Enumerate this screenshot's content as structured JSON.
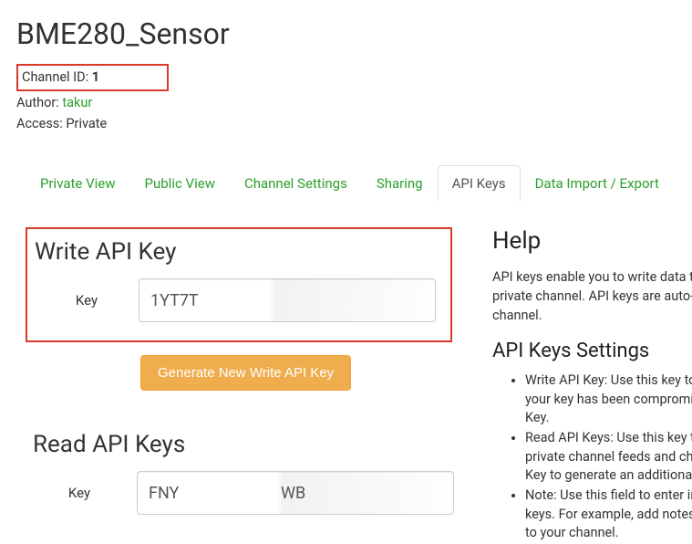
{
  "page_title": "BME280_Sensor",
  "meta": {
    "channel_id_label": "Channel ID: ",
    "channel_id_value": "1",
    "author_label": "Author: ",
    "author_value": "takur",
    "access_label": "Access: ",
    "access_value": "Private"
  },
  "tabs": {
    "private_view": "Private View",
    "public_view": "Public View",
    "channel_settings": "Channel Settings",
    "sharing": "Sharing",
    "api_keys": "API Keys",
    "data_import_export": "Data Import / Export"
  },
  "write": {
    "heading": "Write API Key",
    "key_label": "Key",
    "key_value": "1YT7T",
    "generate_button": "Generate New Write API Key"
  },
  "read": {
    "heading": "Read API Keys",
    "key_label": "Key",
    "key_value": "FNY                         WB"
  },
  "help": {
    "heading": "Help",
    "intro_line1": "API keys enable you to write data to a ch",
    "intro_line2": "private channel. API keys are auto-gene",
    "intro_line3": "channel.",
    "settings_heading": "API Keys Settings",
    "bullet1a": "Write API Key: Use this key to writ",
    "bullet1b": "your key has been compromised,",
    "bullet1c": "Key.",
    "bullet2a": "Read API Keys: Use this key to all",
    "bullet2b": "private channel feeds and charts.",
    "bullet2c": "Key to generate an additional rea",
    "bullet3a": "Note: Use this field to enter inforn",
    "bullet3b": "keys. For example, add notes to k",
    "bullet3c": "to your channel."
  }
}
